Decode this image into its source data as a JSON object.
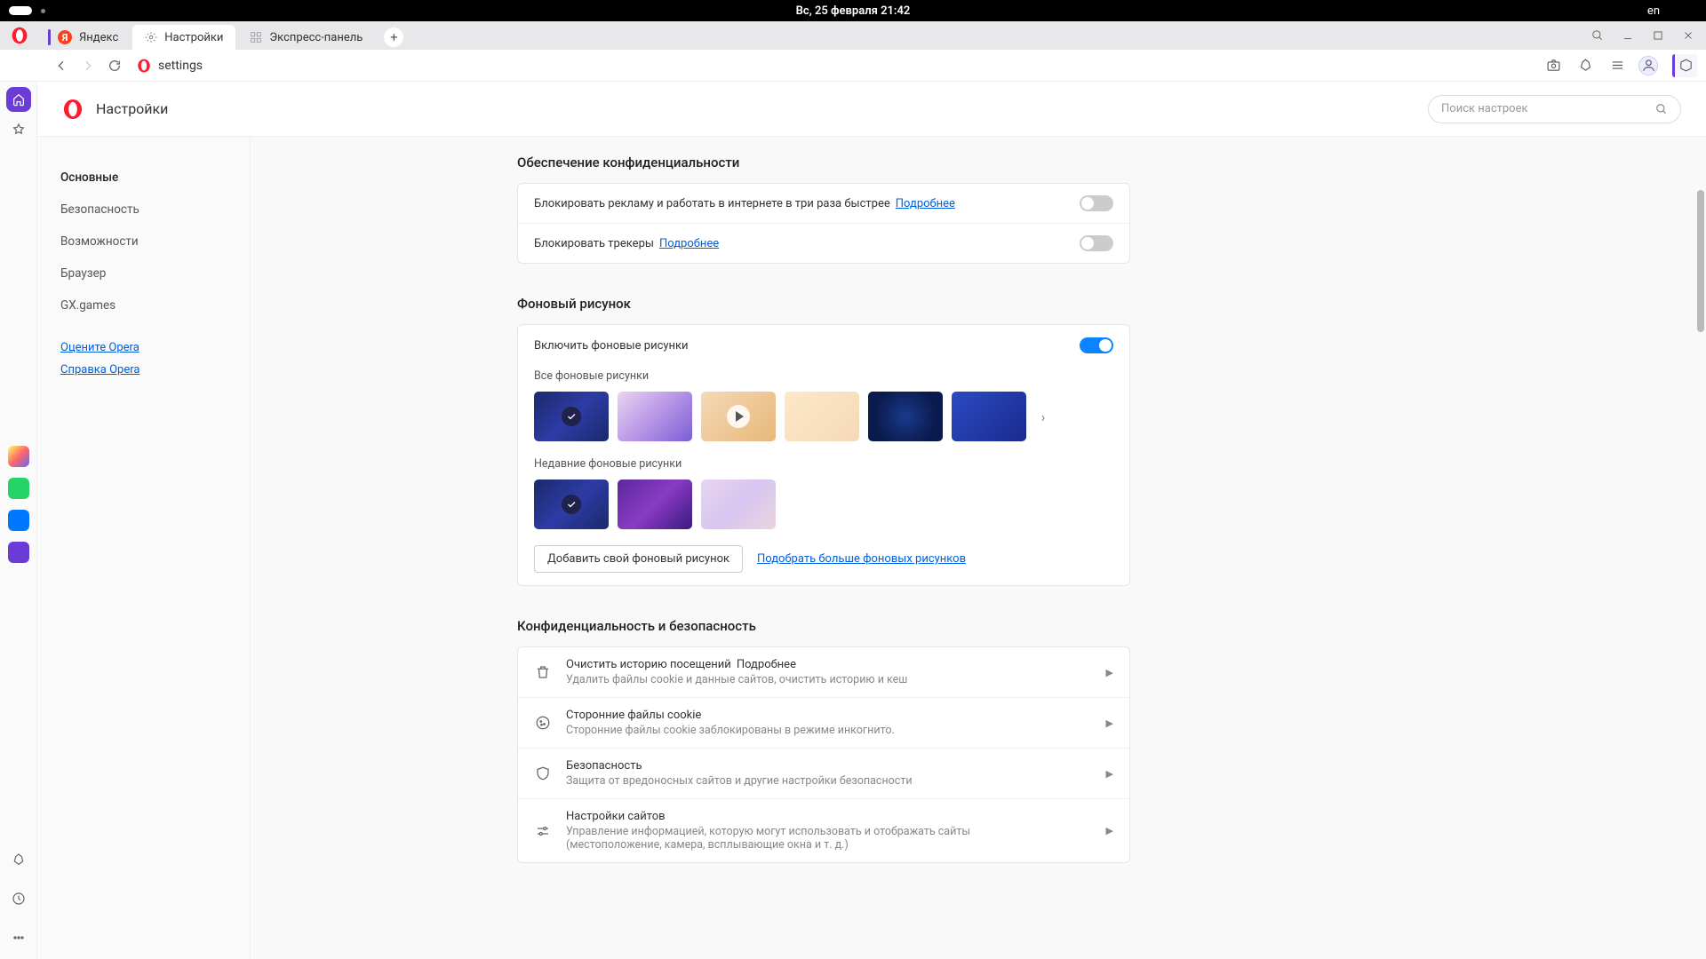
{
  "os": {
    "datetime": "Вс, 25 февраля  21:42",
    "lang": "en"
  },
  "tabs": {
    "t1": "Яндекс",
    "t2": "Настройки",
    "t3": "Экспресс-панель"
  },
  "addr": {
    "url": "settings"
  },
  "settings": {
    "title": "Настройки",
    "search_placeholder": "Поиск настроек",
    "nav": {
      "n1": "Основные",
      "n2": "Безопасность",
      "n3": "Возможности",
      "n4": "Браузер",
      "n5": "GX.games",
      "rate": "Оцените Opera",
      "help": "Справка Opera"
    },
    "privacy": {
      "heading": "Обеспечение конфиденциальности",
      "adblock": "Блокировать рекламу и работать в интернете в три раза быстрее",
      "tracker": "Блокировать трекеры",
      "more": "Подробнее"
    },
    "wallpaper": {
      "heading": "Фоновый рисунок",
      "enable": "Включить фоновые рисунки",
      "all": "Все фоновые рисунки",
      "recent": "Недавние фоновые рисунки",
      "addbtn": "Добавить свой фоновый рисунок",
      "morelink": "Подобрать больше фоновых рисунков"
    },
    "sec": {
      "heading": "Конфиденциальность и безопасность",
      "clear_t": "Очистить историю посещений",
      "clear_d": "Удалить файлы cookie и данные сайтов, очистить историю и кеш",
      "cookie_t": "Сторонние файлы cookie",
      "cookie_d": "Сторонние файлы cookie заблокированы в режиме инкогнито.",
      "safe_t": "Безопасность",
      "safe_d": "Защита от вредоносных сайтов и другие настройки безопасности",
      "site_t": "Настройки сайтов",
      "site_d": "Управление информацией, которую могут использовать и отображать сайты (местоположение, камера, всплывающие окна и т. д.)",
      "more": "Подробнее"
    }
  }
}
